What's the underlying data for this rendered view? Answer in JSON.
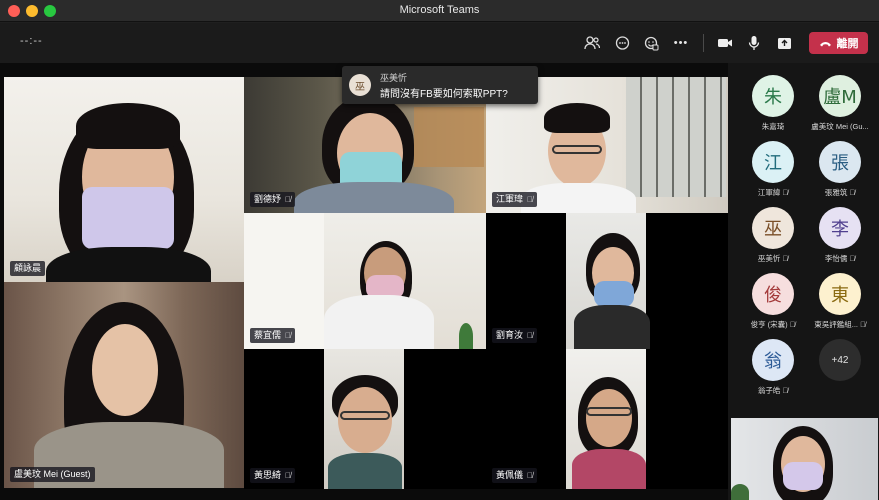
{
  "window": {
    "title": "Microsoft Teams"
  },
  "toolbar": {
    "timer": "--:--",
    "buttons": [
      {
        "name": "participants-icon",
        "glyph": "👥"
      },
      {
        "name": "chat-icon",
        "glyph": "💬"
      },
      {
        "name": "reactions-icon",
        "glyph": "✋"
      },
      {
        "name": "more-icon",
        "glyph": "•••"
      },
      {
        "name": "camera-icon",
        "glyph": "🎥"
      },
      {
        "name": "microphone-icon",
        "glyph": "🎤"
      },
      {
        "name": "share-icon",
        "glyph": "⬆"
      }
    ],
    "leave_label": "離開",
    "leave_color": "#c4314b"
  },
  "notification": {
    "avatar": "巫",
    "sender": "巫美忻",
    "message": "請問沒有FB要如何索取PPT?"
  },
  "tiles": [
    {
      "name": "顧詠晨",
      "muted": false
    },
    {
      "name": "劉德妤",
      "muted": true
    },
    {
      "name": "江軍瑋",
      "muted": true
    },
    {
      "name": "蔡宜儒",
      "muted": true
    },
    {
      "name": "劉育汝",
      "muted": true
    },
    {
      "name": "盧美玟 Mei (Guest)",
      "muted": false
    },
    {
      "name": "黃思綺",
      "muted": true
    },
    {
      "name": "黃佩儀",
      "muted": true
    }
  ],
  "roster": [
    {
      "initial": "朱",
      "name": "朱嘉琦",
      "muted": false,
      "bg": "#dff3e6",
      "fg": "#2b7a4b"
    },
    {
      "initial": "盧M",
      "name": "盧美玟 Mei (Gu...",
      "muted": false,
      "bg": "#dff0e0",
      "fg": "#2f6b3a"
    },
    {
      "initial": "江",
      "name": "江軍緯",
      "muted": true,
      "bg": "#dbf1f5",
      "fg": "#226c7c"
    },
    {
      "initial": "張",
      "name": "張雅筑",
      "muted": true,
      "bg": "#dbe7f0",
      "fg": "#2a5d82"
    },
    {
      "initial": "巫",
      "name": "巫美忻",
      "muted": true,
      "bg": "#efe6dc",
      "fg": "#7a4f28"
    },
    {
      "initial": "李",
      "name": "李怡儒",
      "muted": true,
      "bg": "#e6e1f3",
      "fg": "#50408f"
    },
    {
      "initial": "俊",
      "name": "俊亨 (宋囊)",
      "muted": true,
      "bg": "#f6dede",
      "fg": "#a33a3a"
    },
    {
      "initial": "東",
      "name": "東吳評鑑組...",
      "muted": true,
      "bg": "#fdf1cf",
      "fg": "#8a6a10"
    },
    {
      "initial": "翁",
      "name": "翁子皓",
      "muted": true,
      "bg": "#dde7f5",
      "fg": "#2c5a96"
    }
  ],
  "roster_more": "+42"
}
